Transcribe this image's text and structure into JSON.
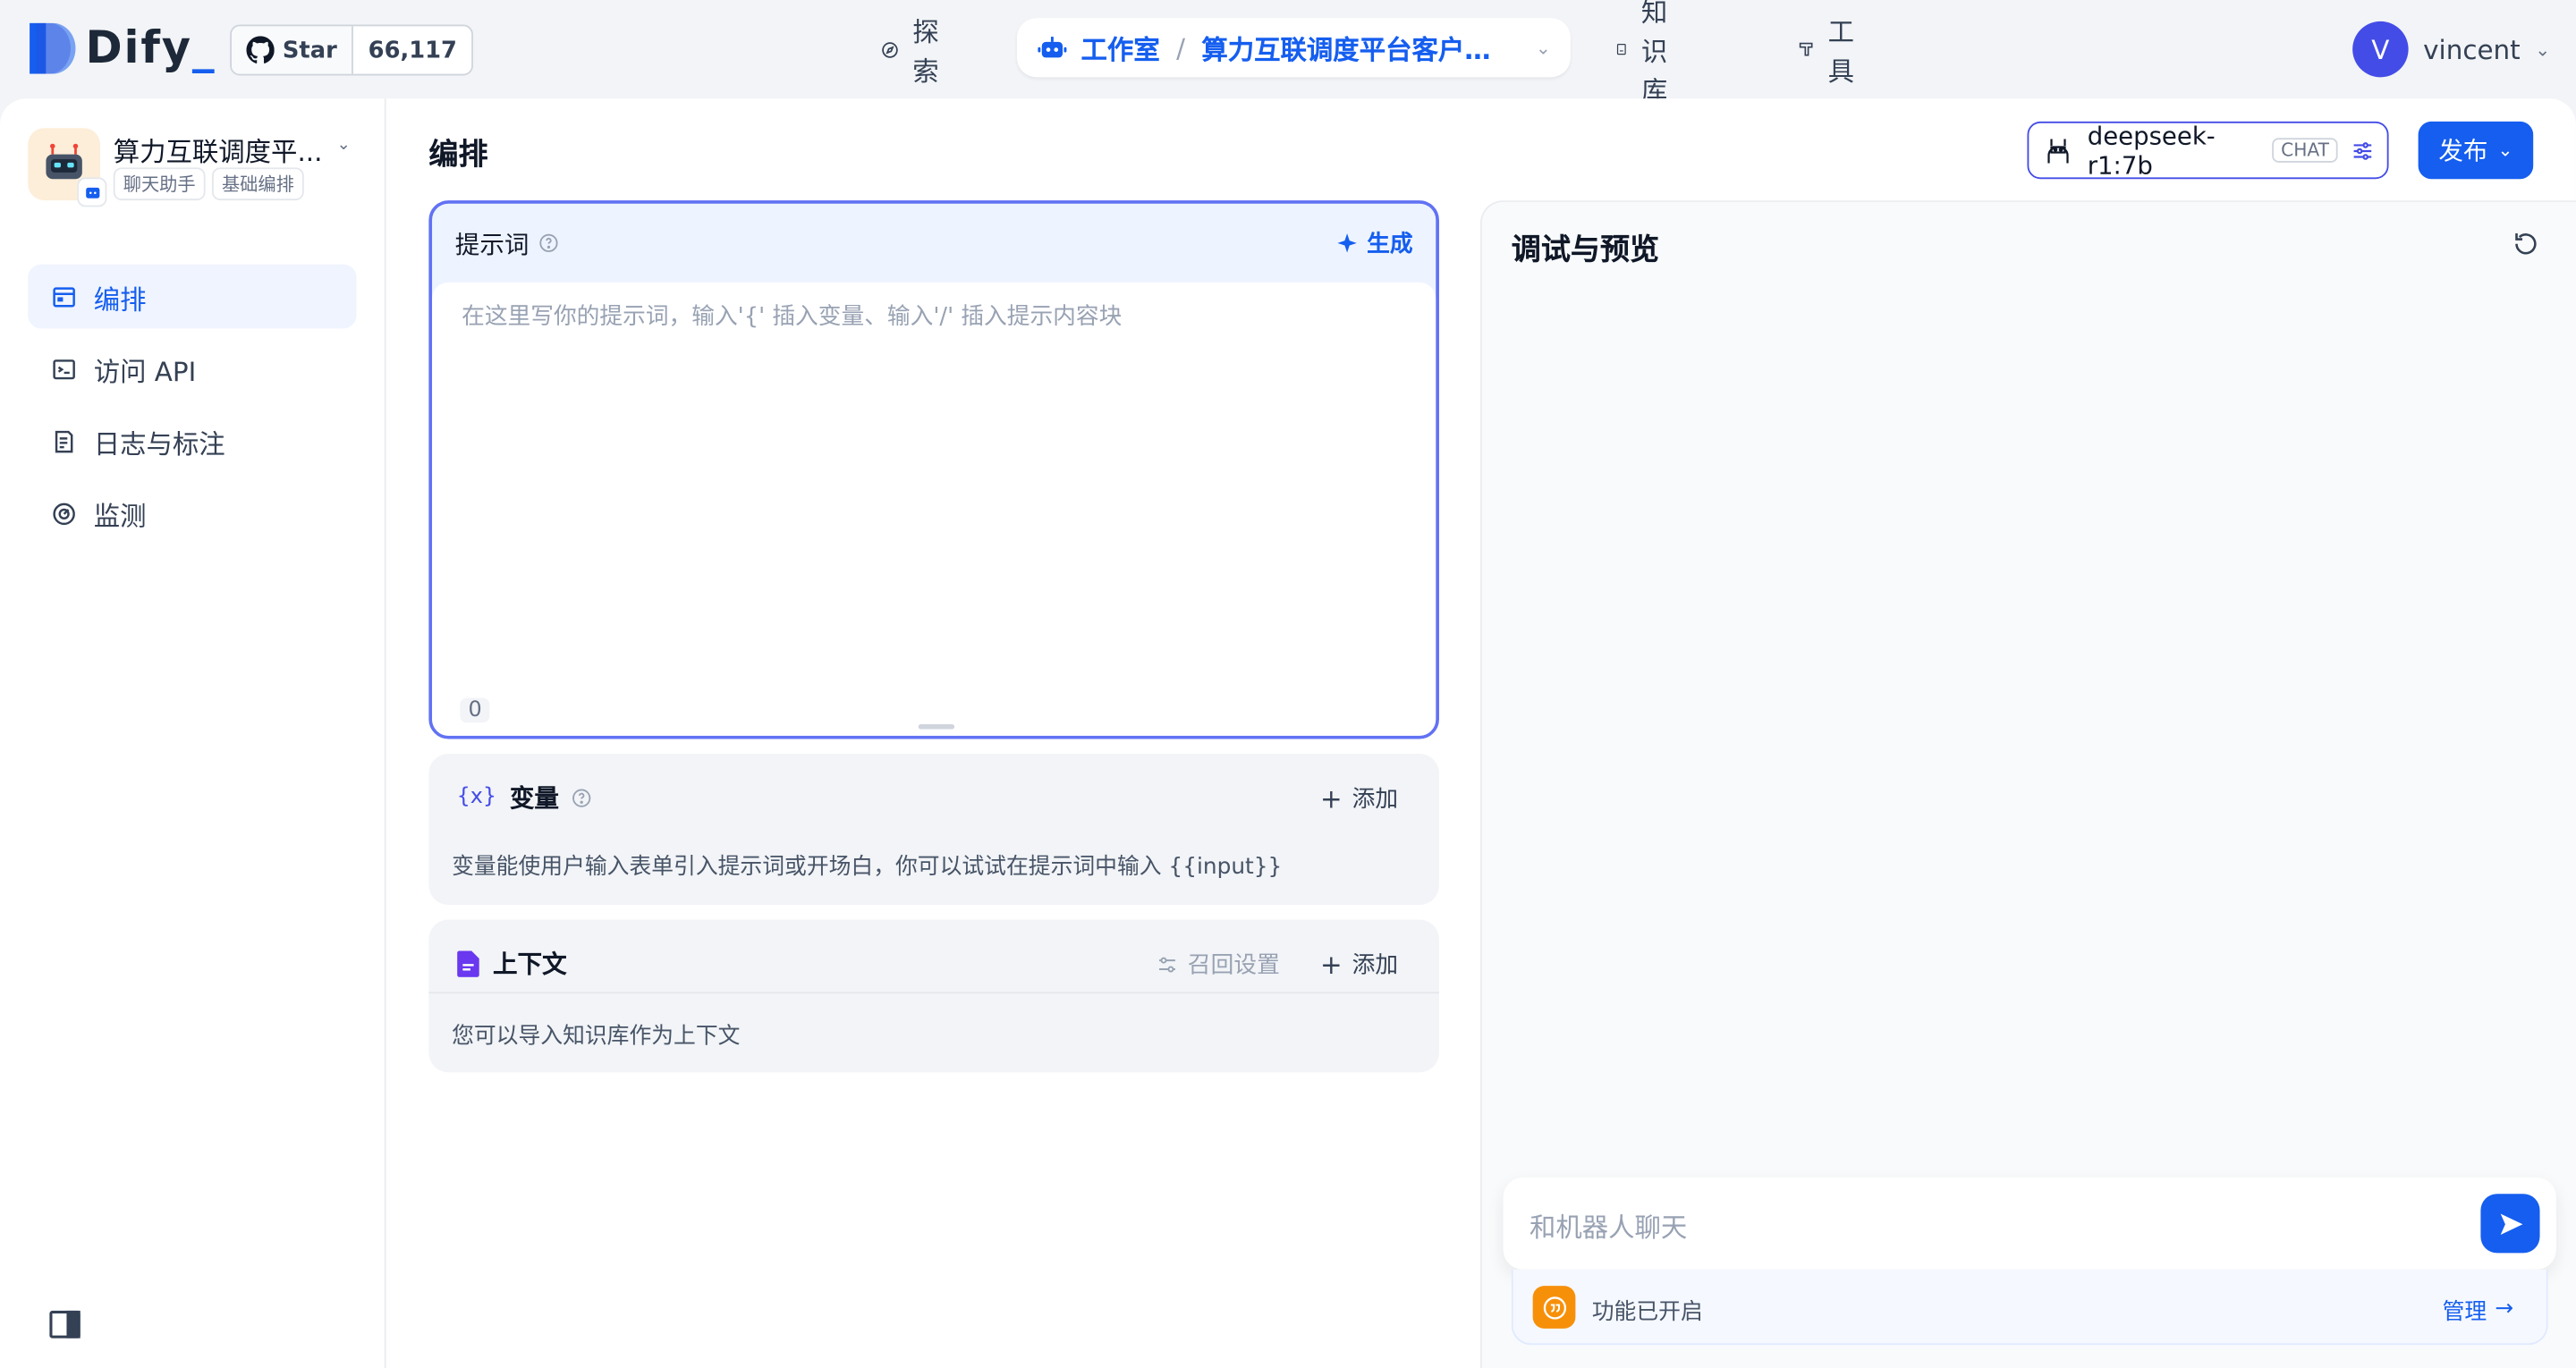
{
  "brand": {
    "name": "Dify",
    "accent": "#155eef"
  },
  "github": {
    "star_label": "Star",
    "star_count": "66,117"
  },
  "nav": {
    "explore": "探索",
    "studio": "工作室",
    "separator": "/",
    "current_app": "算力互联调度平台客户小...",
    "knowledge": "知识库",
    "tools": "工具"
  },
  "user": {
    "initial": "V",
    "name": "vincent"
  },
  "app": {
    "title": "算力互联调度平...",
    "tags": [
      "聊天助手",
      "基础编排"
    ]
  },
  "sidebar": {
    "items": [
      {
        "label": "编排",
        "icon": "layout-icon",
        "active": true
      },
      {
        "label": "访问 API",
        "icon": "terminal-icon",
        "active": false
      },
      {
        "label": "日志与标注",
        "icon": "file-list-icon",
        "active": false
      },
      {
        "label": "监测",
        "icon": "dashboard-icon",
        "active": false
      }
    ]
  },
  "main": {
    "title": "编排",
    "prompt": {
      "label": "提示词",
      "generate": "生成",
      "placeholder": "在这里写你的提示词，输入'{' 插入变量、输入'/' 插入提示内容块",
      "char_count": "0"
    },
    "variables": {
      "icon": "{x}",
      "label": "变量",
      "add": "添加",
      "description": "变量能使用户输入表单引入提示词或开场白，你可以试试在提示词中输入 {{input}}"
    },
    "context": {
      "label": "上下文",
      "recall": "召回设置",
      "add": "添加",
      "description": "您可以导入知识库作为上下文"
    }
  },
  "model": {
    "name": "deepseek-r1:7b",
    "mode": "CHAT"
  },
  "publish": {
    "label": "发布"
  },
  "debug": {
    "title": "调试与预览",
    "input_placeholder": "和机器人聊天",
    "feature_status": "功能已开启",
    "manage": "管理"
  }
}
